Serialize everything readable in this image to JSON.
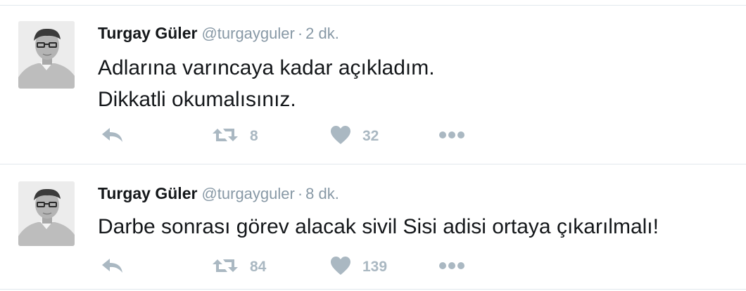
{
  "colors": {
    "name": "#14171a",
    "meta": "#8899a6",
    "action_icon": "#aab8c2",
    "divider": "#e1e8ed"
  },
  "tweets": [
    {
      "author": {
        "name": "Turgay Güler",
        "handle": "@turgayguler"
      },
      "separator": "·",
      "time": "2 dk.",
      "text_lines": [
        "Adlarına varıncaya kadar açıkladım.",
        "Dikkatli okumalısınız."
      ],
      "actions": {
        "reply_icon": "reply-arrow-icon",
        "retweet_icon": "retweet-icon",
        "retweet_count": "8",
        "like_icon": "heart-icon",
        "like_count": "32",
        "more_icon": "ellipsis-icon"
      }
    },
    {
      "author": {
        "name": "Turgay Güler",
        "handle": "@turgayguler"
      },
      "separator": "·",
      "time": "8 dk.",
      "text_lines": [
        "Darbe sonrası görev alacak sivil Sisi adisi ortaya çıkarılmalı!"
      ],
      "actions": {
        "reply_icon": "reply-arrow-icon",
        "retweet_icon": "retweet-icon",
        "retweet_count": "84",
        "like_icon": "heart-icon",
        "like_count": "139",
        "more_icon": "ellipsis-icon"
      }
    }
  ]
}
